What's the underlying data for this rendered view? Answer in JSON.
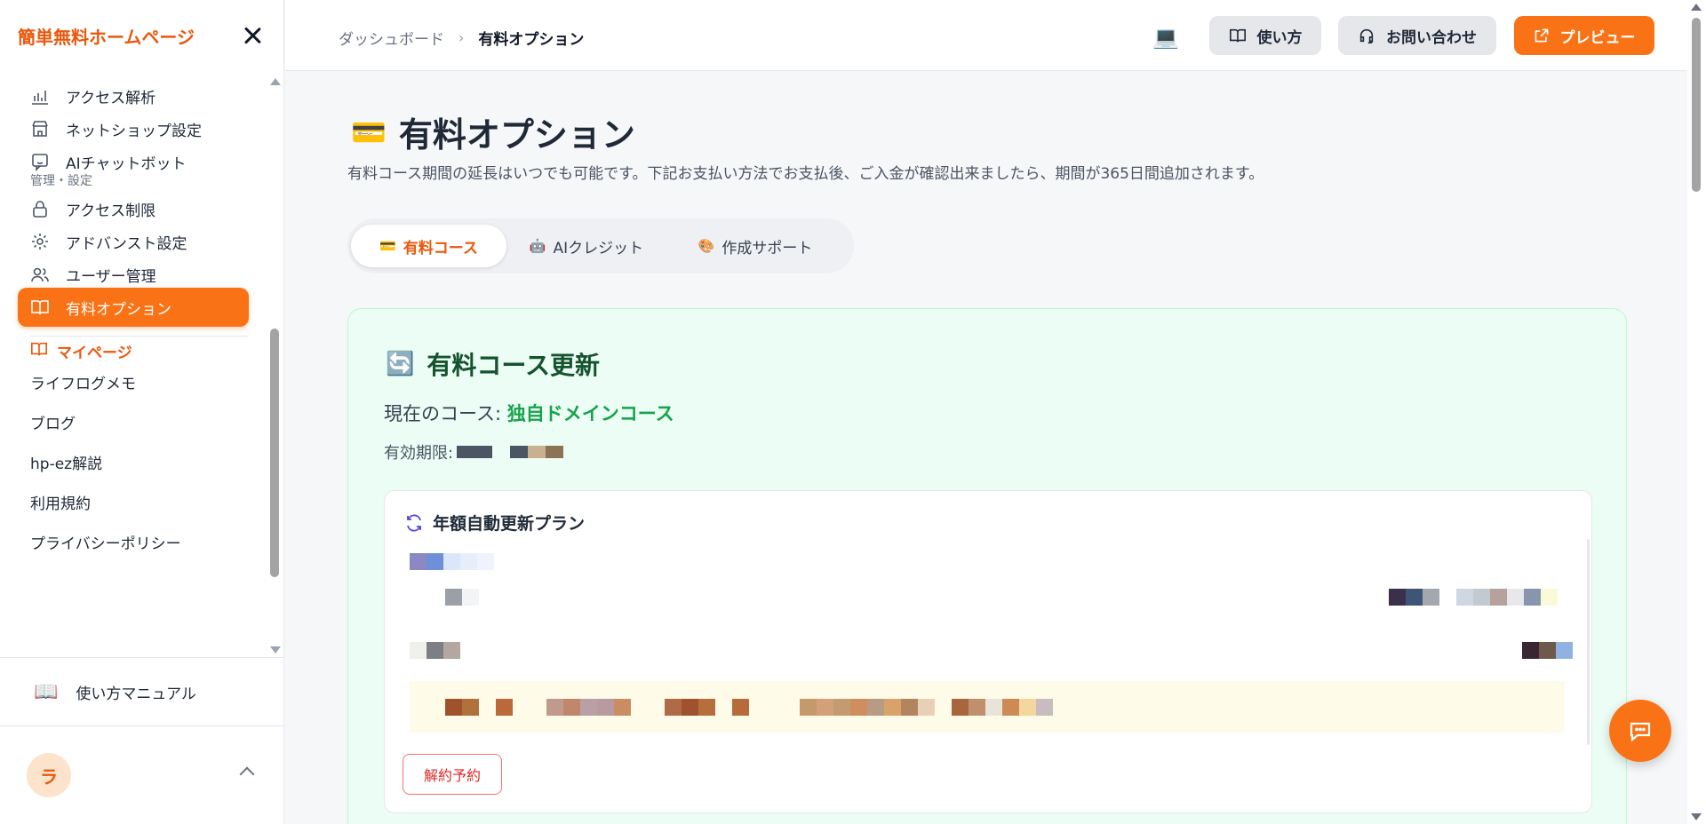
{
  "sidebar": {
    "brand": "簡単無料ホームページ",
    "items": [
      {
        "label": "アクセス解析"
      },
      {
        "label": "ネットショップ設定"
      },
      {
        "label": "AIチャットボット"
      }
    ],
    "section_admin": "管理・設定",
    "admin_items": [
      {
        "label": "アクセス制限"
      },
      {
        "label": "アドバンスト設定"
      },
      {
        "label": "ユーザー管理"
      },
      {
        "label": "有料オプション"
      }
    ],
    "mypage": "マイページ",
    "links": [
      "ライフログメモ",
      "ブログ",
      "hp-ez解説",
      "利用規約",
      "プライバシーポリシー"
    ],
    "manual": "使い方マニュアル",
    "user_initial": "ラ"
  },
  "topbar": {
    "breadcrumb_home": "ダッシュボード",
    "breadcrumb_current": "有料オプション",
    "howto_label": "使い方",
    "contact_label": "お問い合わせ",
    "preview_label": "プレビュー"
  },
  "main": {
    "title": "有料オプション",
    "description": "有料コース期間の延長はいつでも可能です。下記お支払い方法でお支払後、ご入金が確認出来ましたら、期間が365日間追加されます。",
    "tabs": [
      {
        "label": "有料コース",
        "icon": "credit-card"
      },
      {
        "label": "AIクレジット",
        "icon": "robot"
      },
      {
        "label": "作成サポート",
        "icon": "palette"
      }
    ],
    "course": {
      "title": "有料コース更新",
      "current_label": "現在のコース: ",
      "current_value": "独自ドメインコース",
      "expiry_label": "有効期限:",
      "plan_title": "年額自動更新プラン",
      "cancel_label": "解約予約"
    }
  },
  "colors": {
    "accent": "#f97316",
    "success": "#16a34a",
    "card_bg": "#ecfdf5"
  }
}
